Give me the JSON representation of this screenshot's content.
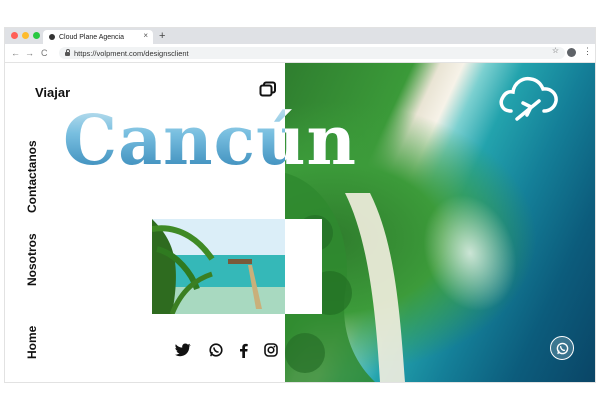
{
  "browser": {
    "tab_title": "Cloud Plane Agencia",
    "tab_close": "×",
    "new_tab": "+",
    "url": "https://volpment.com/designsclient",
    "back": "←",
    "forward": "→",
    "reload": "C",
    "bookmark": "☆",
    "menu": "⋮"
  },
  "page": {
    "logo": "Viajar",
    "hero_title": "Cancún",
    "nav": [
      "Home",
      "Nosotros",
      "Contactanos"
    ]
  },
  "icons": [
    "copy-icon",
    "cloud-plane-icon",
    "twitter-icon",
    "whatsapp-icon",
    "facebook-icon",
    "instagram-icon"
  ],
  "colors": {
    "traffic_red": "#ff5f57",
    "traffic_yellow": "#febc2e",
    "traffic_green": "#28c840",
    "sea": "#1c8fa8",
    "jungle": "#3b9a39"
  }
}
